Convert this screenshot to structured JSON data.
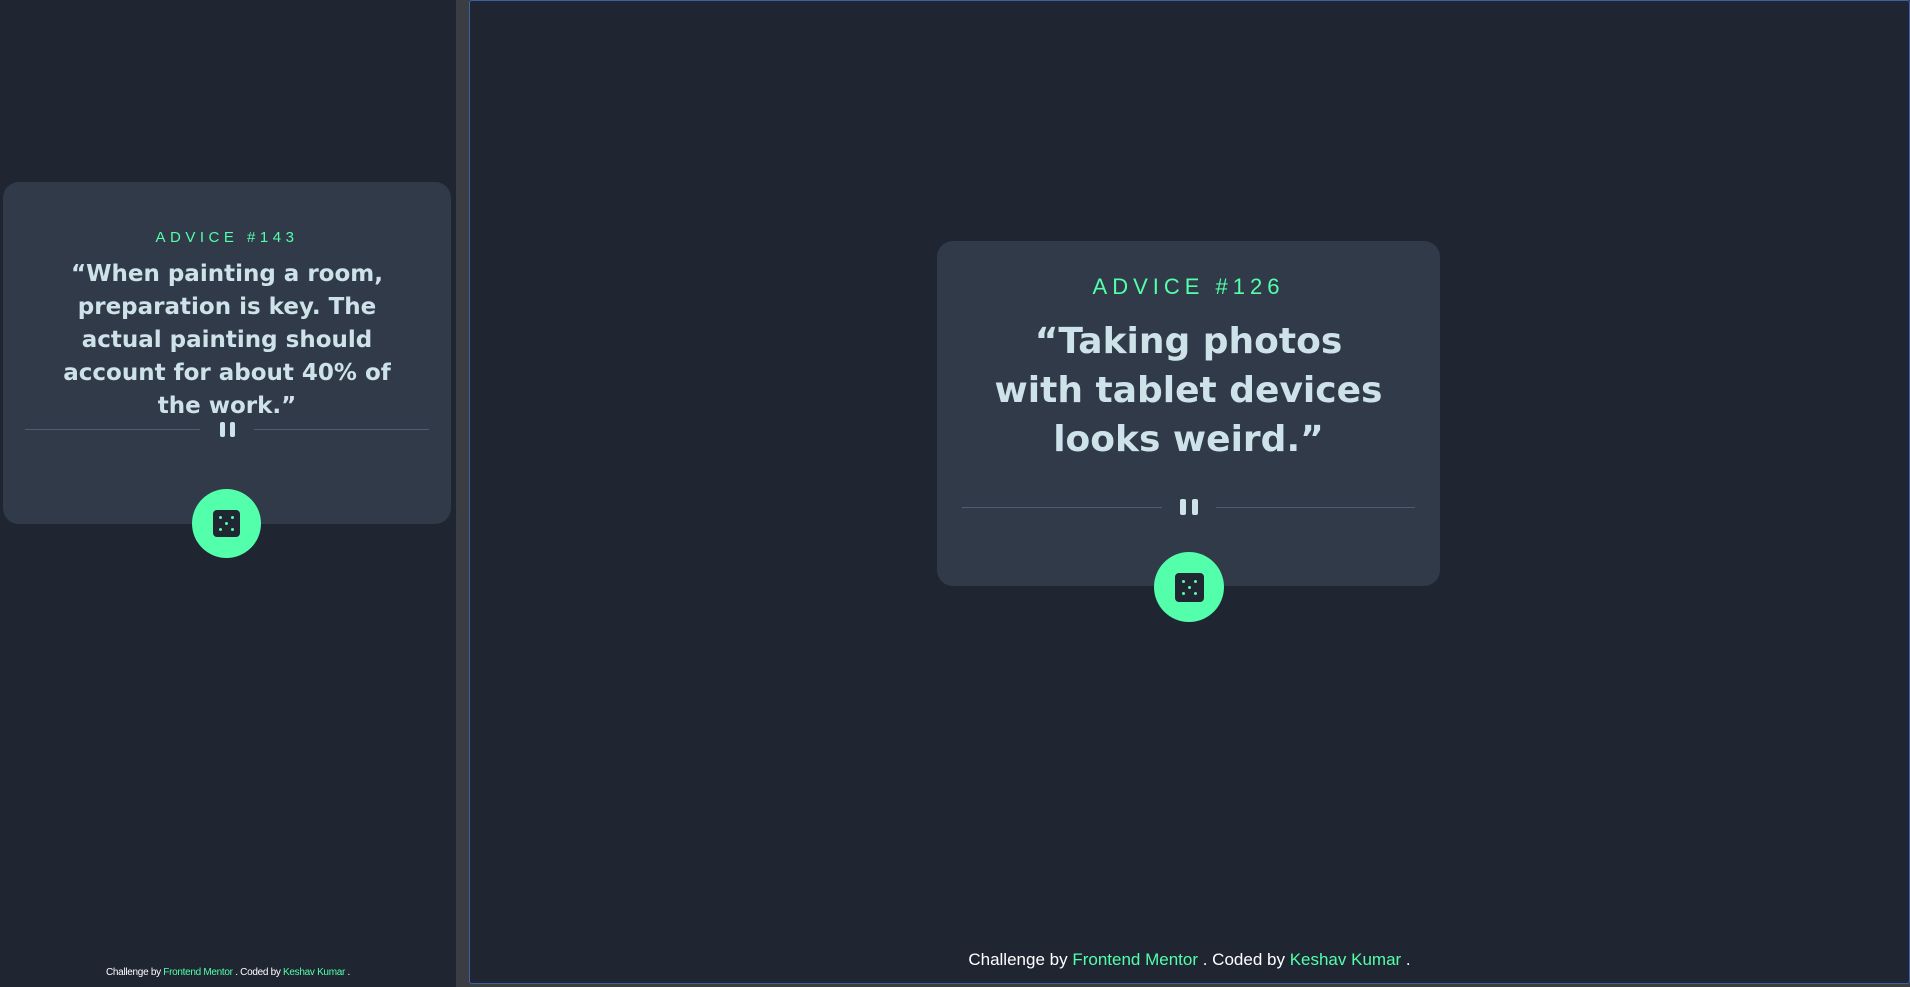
{
  "colors": {
    "background": "#1f2632",
    "card": "#313a48",
    "accent": "#53ffaa",
    "quote_text": "#cee3e9",
    "divider": "#4f5d74"
  },
  "left_view": {
    "card": {
      "advice_label": "ADVICE #143",
      "quote": "“When painting a room, preparation is key. The actual painting should account for about 40% of the work.”",
      "divider_icon": "pause-icon",
      "button_icon": "dice-icon"
    },
    "footer": {
      "prefix": "Challenge by ",
      "challenge_link": "Frontend Mentor",
      "middle": ". Coded by ",
      "author_link": "Keshav Kumar",
      "suffix": "."
    }
  },
  "right_view": {
    "card": {
      "advice_label": "ADVICE #126",
      "quote": "“Taking photos with tablet devices looks weird.”",
      "divider_icon": "pause-icon",
      "button_icon": "dice-icon"
    },
    "footer": {
      "prefix": "Challenge by ",
      "challenge_link": "Frontend Mentor",
      "middle": ". Coded by ",
      "author_link": "Keshav Kumar",
      "suffix": "."
    }
  }
}
